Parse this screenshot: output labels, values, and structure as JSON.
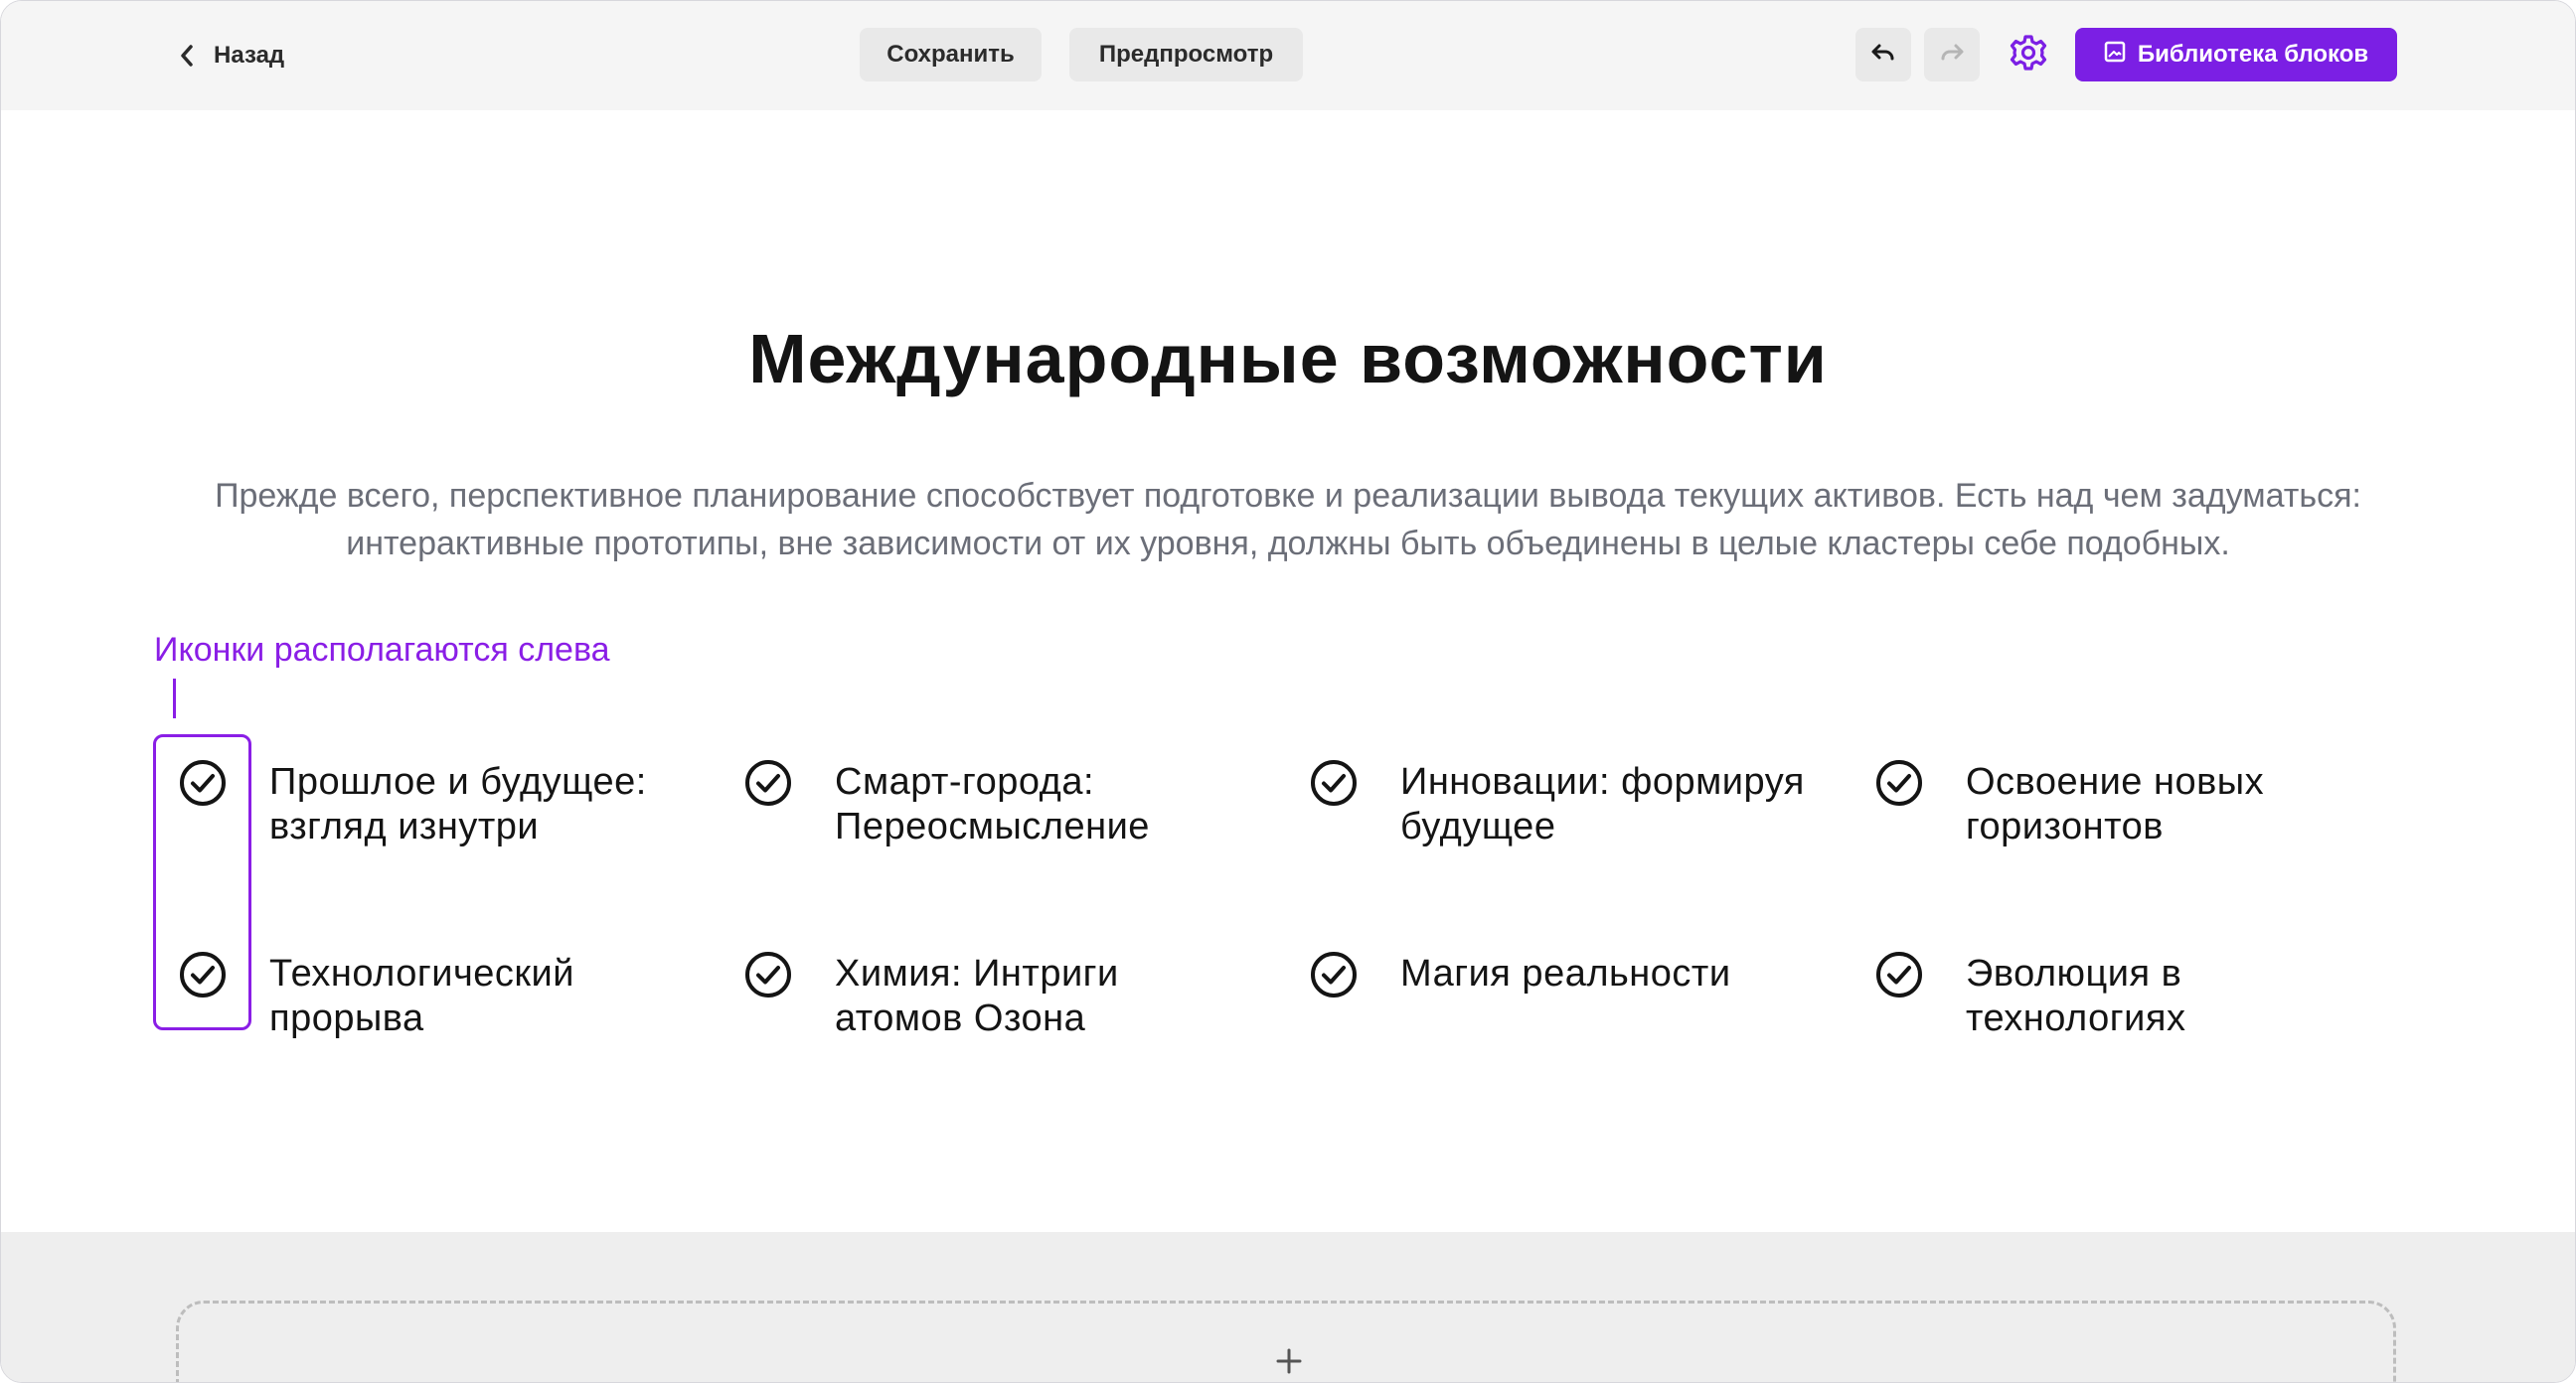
{
  "toolbar": {
    "back_label": "Назад",
    "save_label": "Сохранить",
    "preview_label": "Предпросмотр",
    "library_label": "Библиотека блоков",
    "accent_color": "#7b1fe4"
  },
  "section": {
    "title": "Международные возможности",
    "description": "Прежде всего, перспективное планирование способствует подготовке и реализации вывода текущих активов. Есть над чем задуматься: интерактивные прототипы, вне зависимости от их уровня, должны быть объединены в целые кластеры себе подобных.",
    "annotation": "Иконки располагаются слева",
    "features": [
      {
        "icon": "check-circle-icon",
        "text": "Прошлое и будущее: взгляд изнутри"
      },
      {
        "icon": "check-circle-icon",
        "text": "Смарт-города: Переосмысление"
      },
      {
        "icon": "check-circle-icon",
        "text": "Инновации: формируя будущее"
      },
      {
        "icon": "check-circle-icon",
        "text": "Освоение новых горизонтов"
      },
      {
        "icon": "check-circle-icon",
        "text": "Технологический прорыва"
      },
      {
        "icon": "check-circle-icon",
        "text": "Химия: Интриги атомов Озона"
      },
      {
        "icon": "check-circle-icon",
        "text": "Магия реальности"
      },
      {
        "icon": "check-circle-icon",
        "text": "Эволюция в технологиях"
      }
    ]
  },
  "add_block": {
    "icon": "plus-icon"
  }
}
